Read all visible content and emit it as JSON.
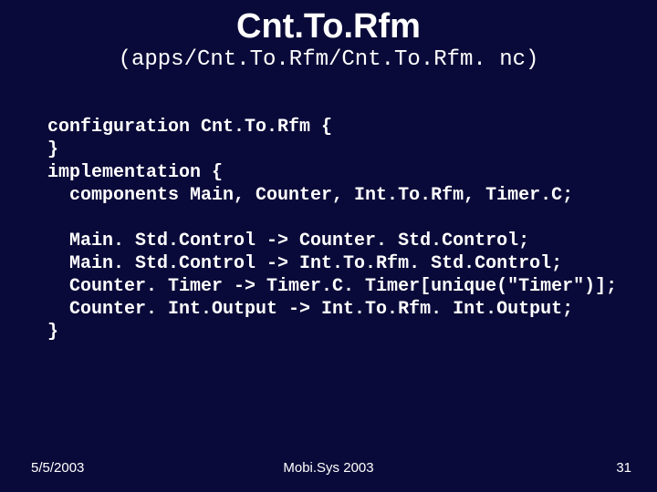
{
  "title": "Cnt.To.Rfm",
  "subtitle": "(apps/Cnt.To.Rfm/Cnt.To.Rfm. nc)",
  "code": "configuration Cnt.To.Rfm {\n}\nimplementation {\n  components Main, Counter, Int.To.Rfm, Timer.C;\n\n  Main. Std.Control -> Counter. Std.Control;\n  Main. Std.Control -> Int.To.Rfm. Std.Control;\n  Counter. Timer -> Timer.C. Timer[unique(\"Timer\")];\n  Counter. Int.Output -> Int.To.Rfm. Int.Output;\n}",
  "footer": {
    "date": "5/5/2003",
    "center": "Mobi.Sys 2003",
    "page": "31"
  }
}
